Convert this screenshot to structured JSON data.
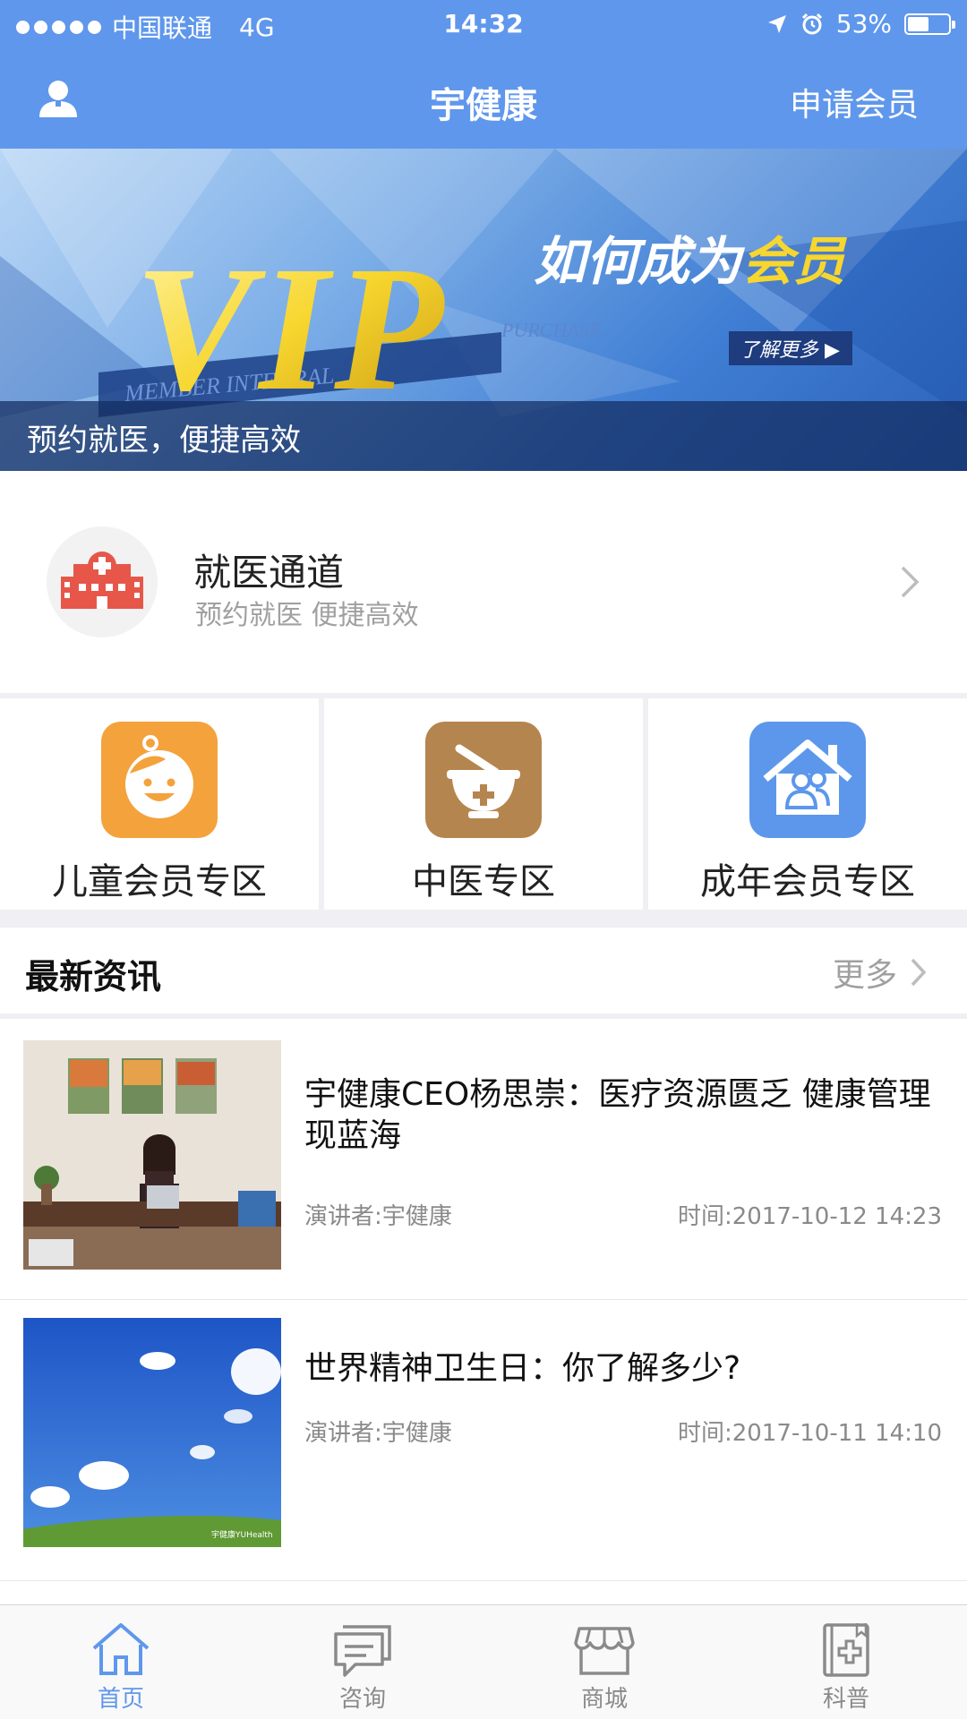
{
  "status_bar": {
    "carrier": "中国联通",
    "network": "4G",
    "time": "14:32",
    "battery": "53%",
    "battery_level": 0.53
  },
  "nav": {
    "title": "宇健康",
    "apply_member": "申请会员",
    "left_icon": "user-icon"
  },
  "banner": {
    "vip_text": "VIP",
    "member_text": "MEMBER INTEGRAL",
    "purchase_text": "PURCHASE",
    "headline_white": "如何成为",
    "headline_yellow": "会员",
    "learn_more": "了解更多 ▶",
    "caption": "预约就医，便捷高效"
  },
  "channel": {
    "title": "就医通道",
    "subtitle": "预约就医 便捷高效",
    "icon": "hospital-icon"
  },
  "zones": [
    {
      "label": "儿童会员专区",
      "icon": "child-face-icon",
      "color": "#f4a23c"
    },
    {
      "label": "中医专区",
      "icon": "mortar-icon",
      "color": "#b5854f"
    },
    {
      "label": "成年会员专区",
      "icon": "family-house-icon",
      "color": "#5c97ec"
    }
  ],
  "news": {
    "title": "最新资讯",
    "more": "更多",
    "items": [
      {
        "headline": "宇健康CEO杨思崇：医疗资源匮乏 健康管理现蓝海",
        "speaker": "演讲者:宇健康",
        "time": "时间:2017-10-12 14:23"
      },
      {
        "headline": "世界精神卫生日：你了解多少?",
        "speaker": "演讲者:宇健康",
        "time": "时间:2017-10-11 14:10",
        "watermark": "宇健康YUHealth"
      }
    ]
  },
  "tabs": [
    {
      "label": "首页",
      "icon": "home-icon",
      "active": true
    },
    {
      "label": "咨询",
      "icon": "chat-icon",
      "active": false
    },
    {
      "label": "商城",
      "icon": "store-icon",
      "active": false
    },
    {
      "label": "科普",
      "icon": "medical-book-icon",
      "active": false
    }
  ],
  "colors": {
    "primary": "#5f97ec",
    "inactive": "#8a8a8a",
    "hospital_red": "#e6574a"
  }
}
